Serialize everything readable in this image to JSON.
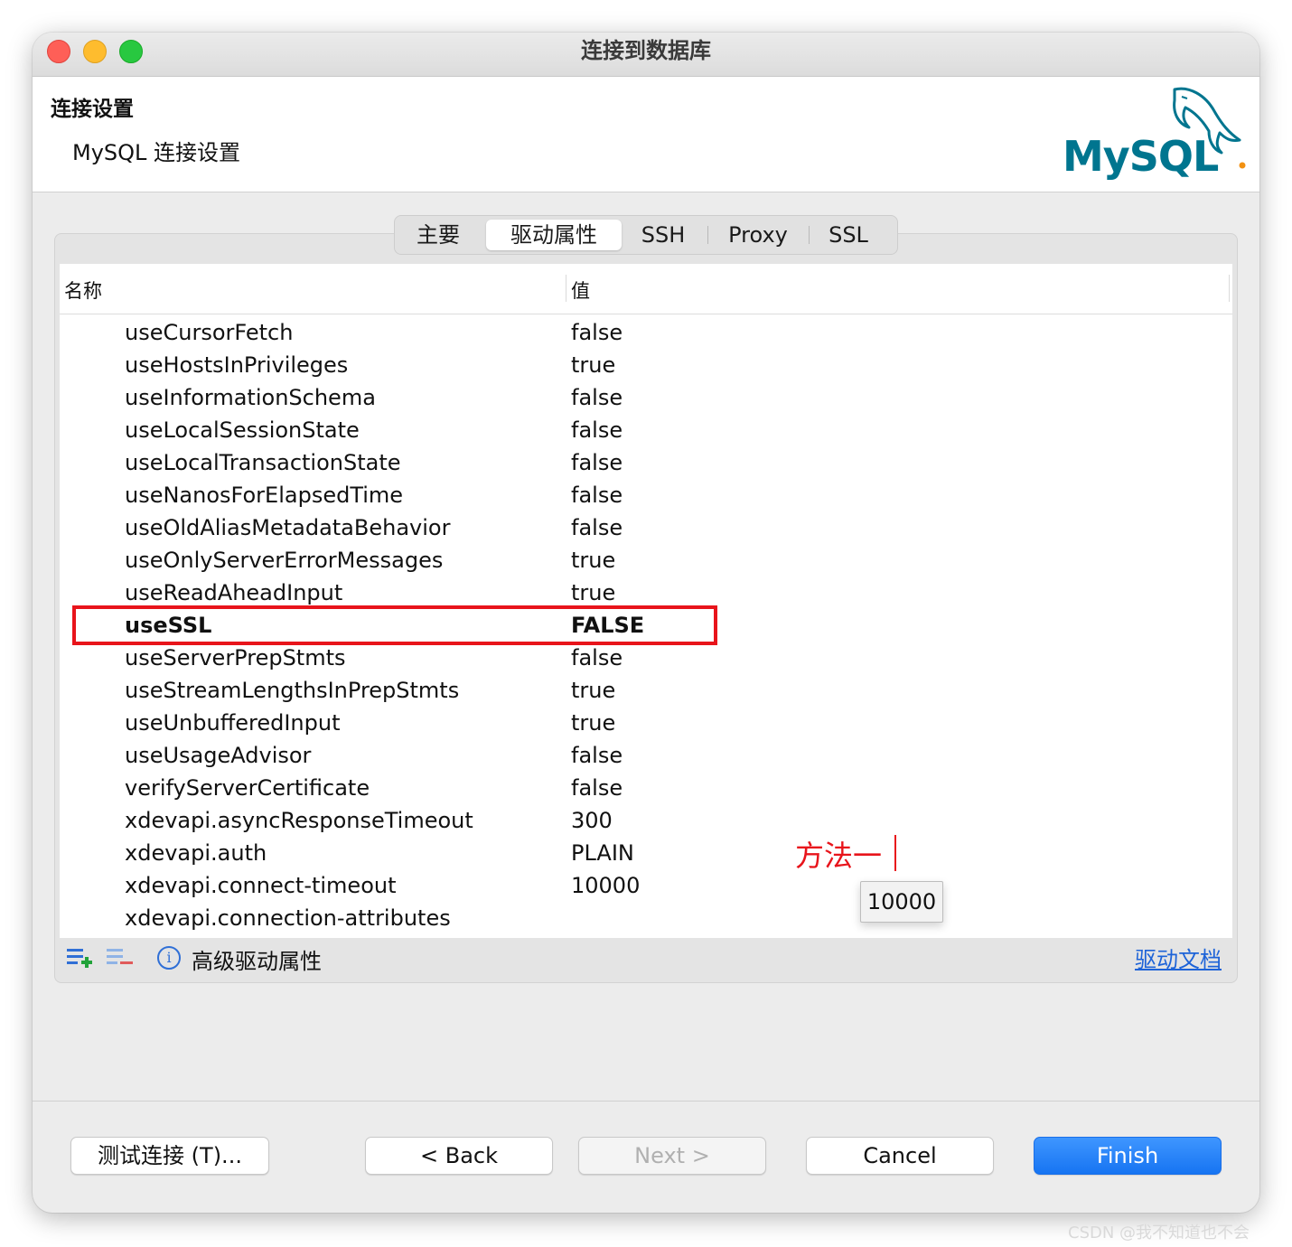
{
  "window": {
    "title": "连接到数据库"
  },
  "header": {
    "title": "连接设置",
    "subtitle": "MySQL 连接设置",
    "logo_text": "MySQL"
  },
  "tabs": [
    {
      "label": "主要",
      "active": false
    },
    {
      "label": "驱动属性",
      "active": true
    },
    {
      "label": "SSH",
      "active": false
    },
    {
      "label": "Proxy",
      "active": false
    },
    {
      "label": "SSL",
      "active": false
    }
  ],
  "table": {
    "columns": {
      "name": "名称",
      "value": "值"
    },
    "rows": [
      {
        "name": "useCursorFetch",
        "value": "false"
      },
      {
        "name": "useHostsInPrivileges",
        "value": "true"
      },
      {
        "name": "useInformationSchema",
        "value": "false"
      },
      {
        "name": "useLocalSessionState",
        "value": "false"
      },
      {
        "name": "useLocalTransactionState",
        "value": "false"
      },
      {
        "name": "useNanosForElapsedTime",
        "value": "false"
      },
      {
        "name": "useOldAliasMetadataBehavior",
        "value": "false"
      },
      {
        "name": "useOnlyServerErrorMessages",
        "value": "true"
      },
      {
        "name": "useReadAheadInput",
        "value": "true"
      },
      {
        "name": "useSSL",
        "value": "FALSE"
      },
      {
        "name": "useServerPrepStmts",
        "value": "false"
      },
      {
        "name": "useStreamLengthsInPrepStmts",
        "value": "true"
      },
      {
        "name": "useUnbufferedInput",
        "value": "true"
      },
      {
        "name": "useUsageAdvisor",
        "value": "false"
      },
      {
        "name": "verifyServerCertificate",
        "value": "false"
      },
      {
        "name": "xdevapi.asyncResponseTimeout",
        "value": "300"
      },
      {
        "name": "xdevapi.auth",
        "value": "PLAIN"
      },
      {
        "name": "xdevapi.connect-timeout",
        "value": "10000"
      },
      {
        "name": "xdevapi.connection-attributes",
        "value": ""
      }
    ]
  },
  "tooltip": {
    "text": "10000"
  },
  "annotation": {
    "text": "方法一",
    "color": "#e8141b"
  },
  "toolbar": {
    "advanced_label": "高级驱动属性",
    "doc_link": "驱动文档"
  },
  "buttons": {
    "test": "测试连接 (T)...",
    "back": "< Back",
    "next": "Next >",
    "cancel": "Cancel",
    "finish": "Finish"
  },
  "watermark": "CSDN @我不知道也不会",
  "colors": {
    "accent": "#1674f2",
    "highlight": "#e8141b",
    "mysql_teal": "#00758f",
    "mysql_orange": "#f29111"
  }
}
